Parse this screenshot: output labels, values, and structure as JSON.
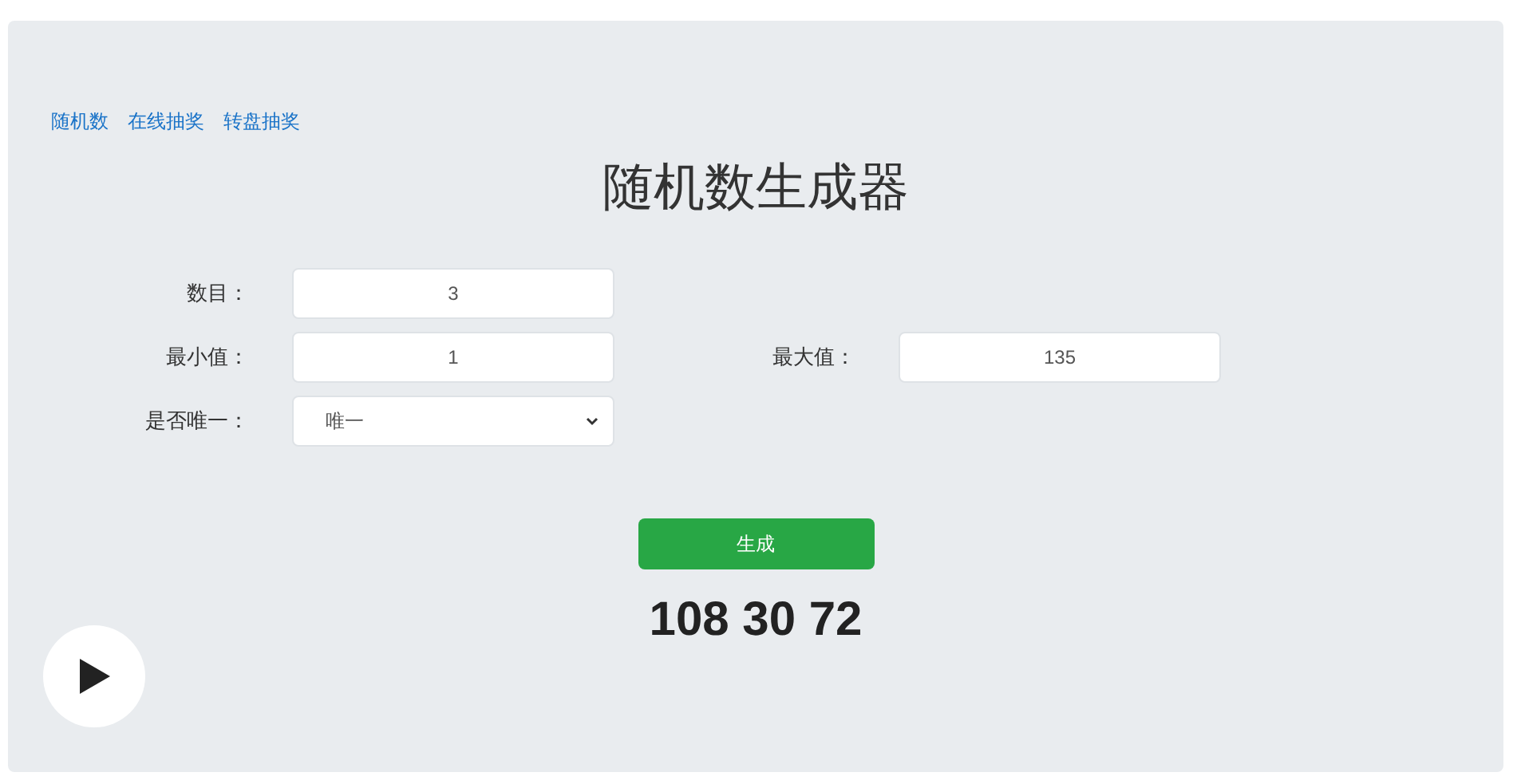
{
  "nav_links": [
    "随机数",
    "在线抽奖",
    "转盘抽奖"
  ],
  "title": "随机数生成器",
  "form_rows": [
    [
      {
        "kind": "input",
        "label": "数目：",
        "value": "3"
      }
    ],
    [
      {
        "kind": "input",
        "label": "最小值：",
        "value": "1"
      },
      {
        "kind": "input",
        "label": "最大值：",
        "value": "135"
      }
    ],
    [
      {
        "kind": "select",
        "label": "是否唯一：",
        "value": "唯一"
      }
    ]
  ],
  "generate_button": "生成",
  "result": "108 30 72"
}
